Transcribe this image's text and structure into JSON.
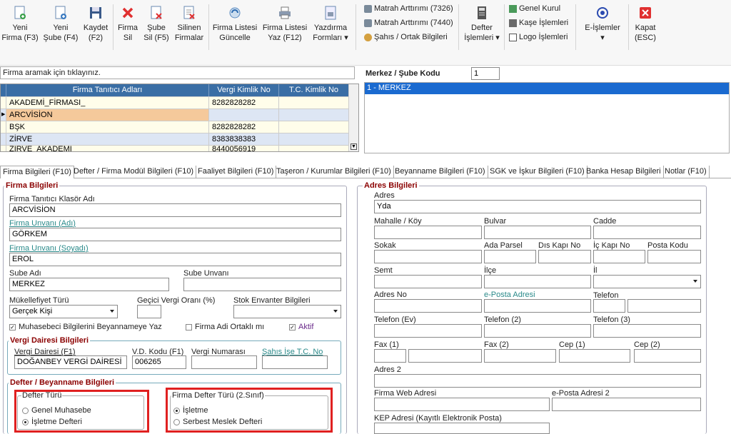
{
  "toolbar": {
    "buttons": [
      {
        "line1": "Yeni",
        "line2": "Firma (F3)",
        "icon": "new-firm-icon"
      },
      {
        "line1": "Yeni",
        "line2": "Şube (F4)",
        "icon": "new-branch-icon"
      },
      {
        "line1": "Kaydet",
        "line2": "(F2)",
        "icon": "save-icon"
      },
      {
        "line1": "Firma",
        "line2": "Sil",
        "icon": "delete-firm-icon"
      },
      {
        "line1": "Şube",
        "line2": "Sil (F5)",
        "icon": "delete-branch-icon"
      },
      {
        "line1": "Silinen",
        "line2": "Firmalar",
        "icon": "deleted-firms-icon"
      },
      {
        "line1": "Firma Listesi",
        "line2": "Güncelle",
        "icon": "refresh-icon"
      },
      {
        "line1": "Firma Listesi",
        "line2": "Yaz (F12)",
        "icon": "print-icon"
      },
      {
        "line1": "Yazdırma",
        "line2": "Formları",
        "icon": "print-forms-icon"
      },
      {
        "line1": "Defter",
        "line2": "İşlemleri",
        "icon": "ledger-icon"
      },
      {
        "line1": "E-İşlemler",
        "line2": "",
        "icon": "e-operations-icon"
      },
      {
        "line1": "Kapat",
        "line2": "(ESC)",
        "icon": "close-icon"
      }
    ],
    "small": [
      "Matrah Arttırımı (7326)",
      "Matrah Arttırımı (7440)",
      "Şahıs / Ortak Bilgileri",
      "Genel Kurul",
      "Kaşe İşlemleri",
      "Logo İşlemleri"
    ]
  },
  "search": {
    "placeholder": "Firma aramak için tıklayınız."
  },
  "firm_grid": {
    "headers": [
      "Firma Tanıtıcı Adları",
      "Vergi Kimlik No",
      "T.C. Kimlik No"
    ],
    "rows": [
      [
        "AKADEMİ_FİRMASI_",
        "8282828282",
        ""
      ],
      [
        "ARCVİSİON",
        "",
        ""
      ],
      [
        "BŞK",
        "8282828282",
        ""
      ],
      [
        "ZİRVE",
        "8383838383",
        ""
      ],
      [
        "ZİRVE_AKADEMİ",
        "8440056919",
        ""
      ]
    ]
  },
  "branch": {
    "label": "Merkez / Şube Kodu",
    "code": "1",
    "items": [
      "1 - MERKEZ"
    ]
  },
  "tabs": [
    "Firma Bilgileri (F10)",
    "Defter / Firma Modül Bilgileri (F10)",
    "Faaliyet Bilgileri (F10)",
    "Taşeron / Kurumlar Bilgileri (F10)",
    "Beyanname Bilgileri (F10)",
    "SGK ve İşkur Bilgileri (F10)",
    "Banka Hesap Bilgileri",
    "Notlar (F10)"
  ],
  "firma": {
    "section": "Firma Bilgileri",
    "klasor_label": "Firma  Tanıtıcı Klasör Adı",
    "klasor_value": "ARCVİSİON",
    "unvan_adi_label": "Firma  Unvanı (Adı)",
    "unvan_adi_value": "GÖRKEM",
    "unvan_soyadi_label": "Firma  Unvanı (Soyadı)",
    "unvan_soyadi_value": "EROL",
    "sube_adi_label": "Sube Adı",
    "sube_adi_value": "MERKEZ",
    "sube_unvani_label": "Sube Unvanı",
    "sube_unvani_value": "",
    "mukellefiyet_label": "Mükellefiyet Türü",
    "mukellefiyet_value": "Gerçek Kişi",
    "gecici_label": "Geçici Vergi Oranı (%)",
    "gecici_value": "",
    "stok_label": "Stok Envanter Bilgileri",
    "stok_value": "",
    "chk1": "Muhasebeci Bilgilerini Beyannameye Yaz",
    "chk2": "Firma Adi Ortaklı mı",
    "chk3": "Aktif"
  },
  "vergi": {
    "section": "Vergi Dairesi Bilgileri",
    "daire_label": "Vergi Dairesi (F1)",
    "daire_value": "DOĞANBEY VERGİ DAİRESİ",
    "vd_kodu_label": "V.D. Kodu (F1)",
    "vd_kodu_value": "006265",
    "numara_label": "Vergi Numarası",
    "numara_value": "",
    "sahis_label": "Şahıs İşe T.C. No",
    "sahis_value": ""
  },
  "defter": {
    "section": "Defter / Beyanname Bilgileri",
    "turu_label": "Defter Türü",
    "turu_options": [
      "Genel Muhasebe",
      "İşletme Defteri"
    ],
    "turu_selected": "İşletme Defteri",
    "firma_turu_label": "Firma Defter Türü (2.Sınıf)",
    "firma_turu_options": [
      "İşletme",
      "Serbest Meslek Defteri"
    ],
    "firma_turu_selected": "İşletme"
  },
  "adres": {
    "section": "Adres Bilgileri",
    "adres_label": "Adres",
    "adres_value": "Yda",
    "mahalle": "Mahalle / Köy",
    "bulvar": "Bulvar",
    "cadde": "Cadde",
    "sokak": "Sokak",
    "ada_parsel": "Ada Parsel",
    "dis_kapi": "Dıs Kapı No",
    "ic_kapi": "İç Kapı No",
    "posta_kodu": "Posta Kodu",
    "semt": "Semt",
    "ilce": "İlçe",
    "il": "İl",
    "adres_no": "Adres No",
    "eposta": "e-Posta Adresi",
    "telefon": "Telefon",
    "telefon_ev": "Telefon (Ev)",
    "telefon2": "Telefon (2)",
    "telefon3": "Telefon (3)",
    "fax1": "Fax (1)",
    "fax2": "Fax (2)",
    "cep1": "Cep (1)",
    "cep2": "Cep (2)",
    "adres2": "Adres 2",
    "web": "Firma Web Adresi",
    "eposta2": "e-Posta Adresi 2",
    "kep": "KEP Adresi (Kayıtlı Elektronik Posta)"
  }
}
